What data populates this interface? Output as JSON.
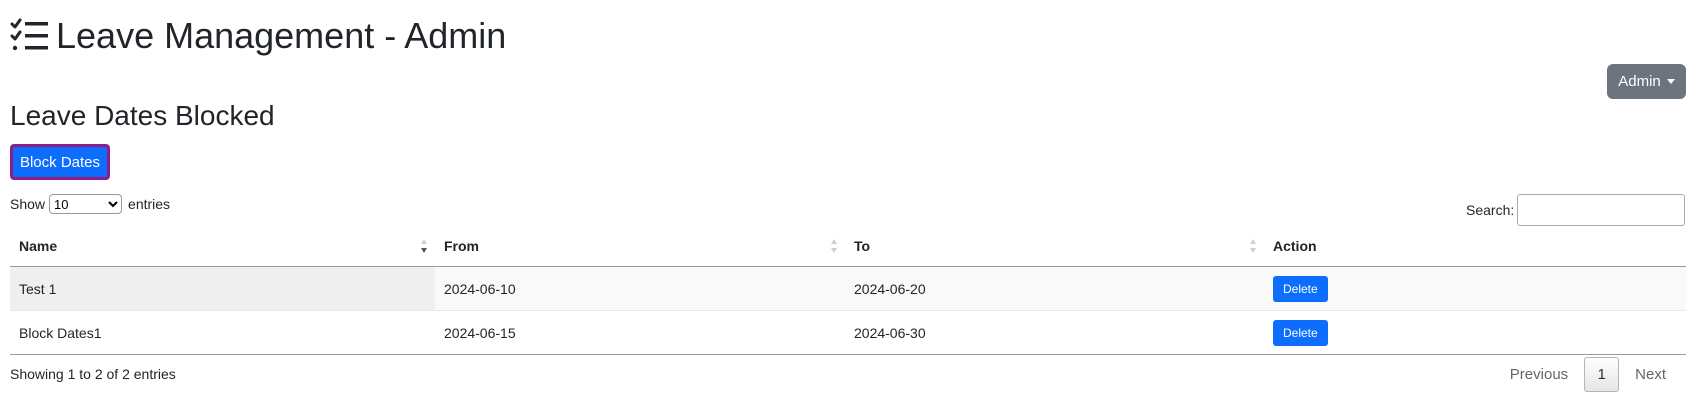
{
  "header": {
    "title": "Leave Management - Admin"
  },
  "user_menu": {
    "label": "Admin"
  },
  "page": {
    "title": "Leave Dates Blocked",
    "block_button": "Block Dates"
  },
  "table_controls": {
    "show_label": "Show",
    "length_value": "10",
    "entries_label": "entries",
    "search_label": "Search:",
    "search_value": ""
  },
  "table": {
    "columns": [
      "Name",
      "From",
      "To",
      "Action"
    ],
    "rows": [
      {
        "name": "Test 1",
        "from": "2024-06-10",
        "to": "2024-06-20",
        "action": "Delete"
      },
      {
        "name": "Block Dates1",
        "from": "2024-06-15",
        "to": "2024-06-30",
        "action": "Delete"
      }
    ]
  },
  "footer": {
    "info": "Showing 1 to 2 of 2 entries",
    "previous": "Previous",
    "page": "1",
    "next": "Next"
  },
  "colors": {
    "primary": "#0d6efd",
    "secondary": "#6c757d",
    "highlight_outline": "#8e1f87"
  },
  "icons": {
    "title_icon": "list-check-icon",
    "sort": "sort-arrows-icon"
  }
}
